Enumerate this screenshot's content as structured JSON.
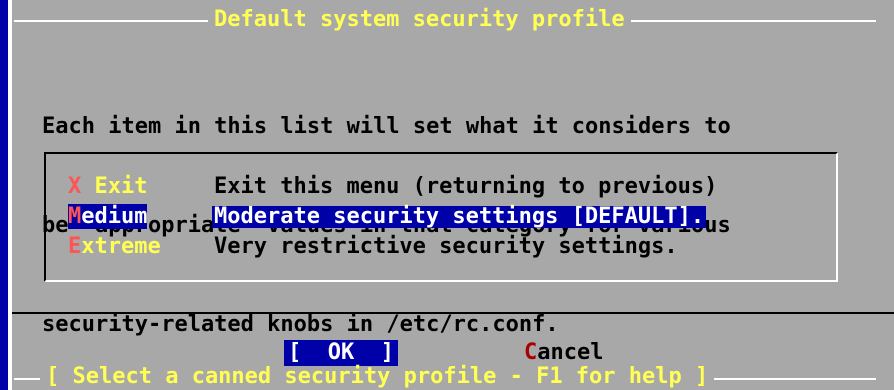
{
  "dialog": {
    "title": "Default system security profile",
    "description_lines": [
      "Each item in this list will set what it considers to",
      "be \"appropriate\" values in that category for various",
      "security-related knobs in /etc/rc.conf."
    ]
  },
  "menu": {
    "items": [
      {
        "hotkey": "X",
        "tag_rest": " Exit",
        "description": "Exit this menu (returning to previous)",
        "selected": false
      },
      {
        "hotkey": "M",
        "tag_rest": "edium",
        "description": "Moderate security settings [DEFAULT].",
        "selected": true
      },
      {
        "hotkey": "E",
        "tag_rest": "xtreme",
        "description": "Very restrictive security settings.",
        "selected": false
      }
    ]
  },
  "buttons": {
    "ok_label": "[  OK  ]",
    "cancel_hotkey": "C",
    "cancel_rest": "ancel"
  },
  "status_bar": {
    "text": "[ Select a canned security profile - F1 for help ]"
  },
  "colors": {
    "background": "#0000a8",
    "dialog": "#a8a8a8",
    "title": "#ffff54",
    "hotkey": "#ff5454",
    "highlight": "#0000a8"
  }
}
